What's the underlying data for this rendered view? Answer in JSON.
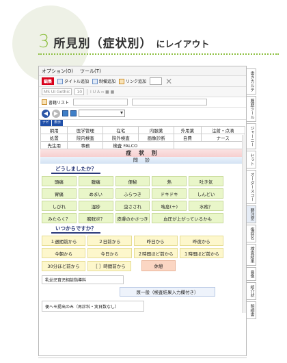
{
  "header": {
    "number": "3",
    "title": "所見別（症状別）",
    "subtitle": "にレイアウト"
  },
  "menu": [
    "オプション(O)",
    "ツール(T)"
  ],
  "toolbar": {
    "edit": "編集",
    "title_add": "タイトル追加",
    "hint_add": "制備追加",
    "link_add": "リンク追加"
  },
  "fontbar": {
    "font": "MS UI Gothic",
    "size": "10",
    "tools": "I  U  A  ▫  ■  ■"
  },
  "list_label": "書籍リスト",
  "mini_tabs": [
    "ナビ",
    "表示"
  ],
  "category_rows": [
    [
      "網用",
      "医学管理",
      "在宅",
      "内服薬",
      "外用薬",
      "注射・点滴"
    ],
    [
      "処置",
      "院内検査",
      "院外検査",
      "画像診断",
      "自費",
      "ナース"
    ],
    [
      "先生用",
      "事務",
      "検査 FALCO",
      "",
      "",
      ""
    ]
  ],
  "band_main": "症 状 別",
  "band_sub": "問 診",
  "q1": "どうしましたか？",
  "symptoms": [
    {
      "label": "頭痛",
      "wide": false
    },
    {
      "label": "腹痛",
      "wide": false
    },
    {
      "label": "便秘",
      "wide": false
    },
    {
      "label": "熱",
      "wide": false
    },
    {
      "label": "吐き気",
      "wide": false
    },
    {
      "label": "胃痛",
      "wide": false
    },
    {
      "label": "めまい",
      "wide": false
    },
    {
      "label": "ふらつき",
      "wide": false
    },
    {
      "label": "ドキドキ",
      "wide": false
    },
    {
      "label": "しんどい",
      "wide": false
    },
    {
      "label": "しびれ",
      "wide": false
    },
    {
      "label": "湿疹",
      "wide": false
    },
    {
      "label": "虫さされ",
      "wide": false
    },
    {
      "label": "喘息(＋)",
      "wide": false
    },
    {
      "label": "水疱？",
      "wide": false
    },
    {
      "label": "みたらく？",
      "wide": false
    },
    {
      "label": "膀胱炎？",
      "wide": false
    },
    {
      "label": "皮膚のかさつき",
      "wide": false
    },
    {
      "label": "血圧が上がっているかも",
      "wide": true
    }
  ],
  "q2": "いつからですか？",
  "when": [
    "１週間前から",
    "２日前から",
    "昨日から",
    "昨夜から",
    "今朝から",
    "今日から",
    "２時間ほど前から",
    "１時間ほど前から"
  ],
  "when_last": [
    "30分ほど前から",
    "［ ］時間前から"
  ],
  "rest": "休憩",
  "infant": "乳幼児育児相談指導料",
  "general": "尿一般（検査結果入力欄付き）",
  "stool": "便ヘモ提出のみ（再診料・実日数なし）",
  "side_tabs": [
    "書きカルテ",
    "履歴ツール",
    "ジャーニー",
    "セット",
    "オーダースコー",
    "要注意",
    "傷病名",
    "検査結果",
    "画像",
    "紹介状",
    "明細書"
  ],
  "colors": {
    "accent_green": "#8cbf3f",
    "symptom_bg": "#e9f6c9",
    "when_bg": "#fdf7cc",
    "rest_bg": "#fbd6c3",
    "tab_blue": "#1f4fa8"
  }
}
